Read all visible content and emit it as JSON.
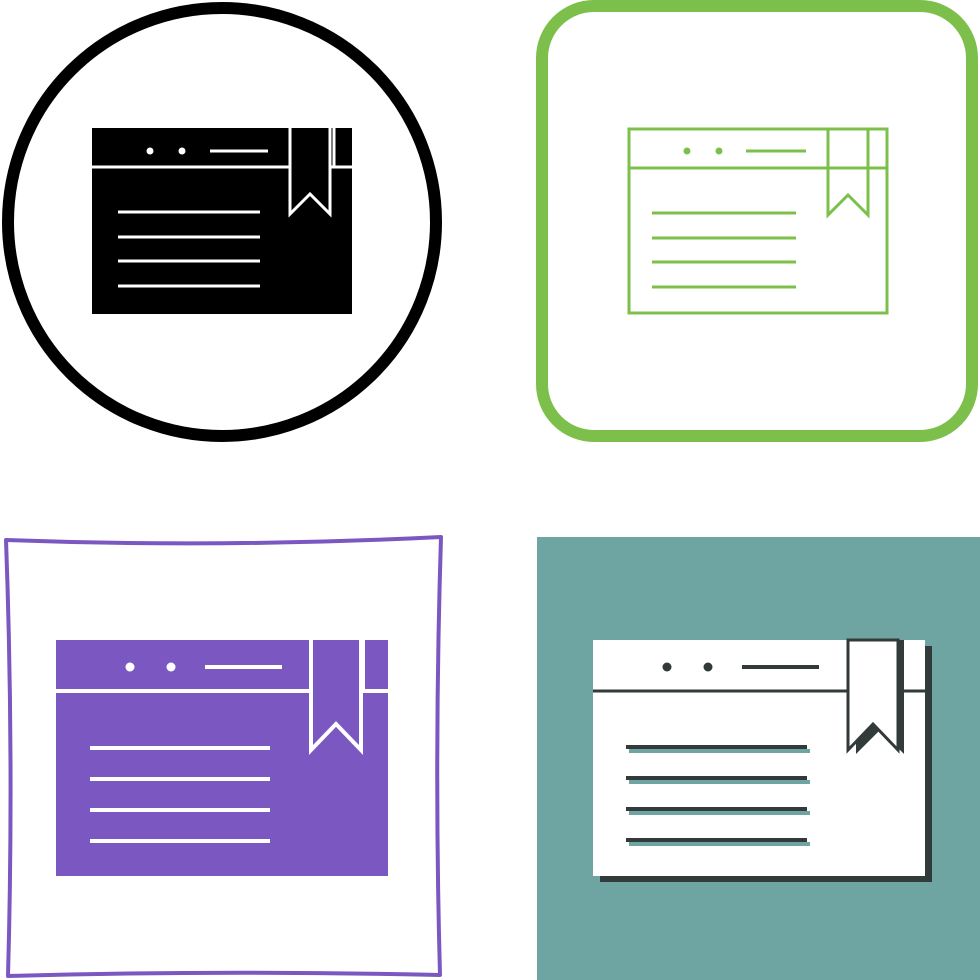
{
  "colors": {
    "black": "#000000",
    "green": "#7cc04b",
    "purple": "#7b57c1",
    "teal": "#6ea5a3",
    "dark": "#333a3a",
    "white": "#ffffff"
  },
  "variants": [
    {
      "style": "glyph",
      "frame": "circle",
      "frame_color": "#000000",
      "icon_color": "#000000"
    },
    {
      "style": "outline",
      "frame": "rounded-square",
      "frame_color": "#7cc04b",
      "icon_color": "#7cc04b"
    },
    {
      "style": "filled",
      "frame": "hand-drawn-square",
      "frame_color": "#7b57c1",
      "icon_color": "#7b57c1"
    },
    {
      "style": "flat-shadow",
      "frame": "filled-square",
      "frame_color": "#6ea5a3",
      "icon_color": "#ffffff"
    }
  ],
  "icon": "bookmarked-browser-window-icon"
}
